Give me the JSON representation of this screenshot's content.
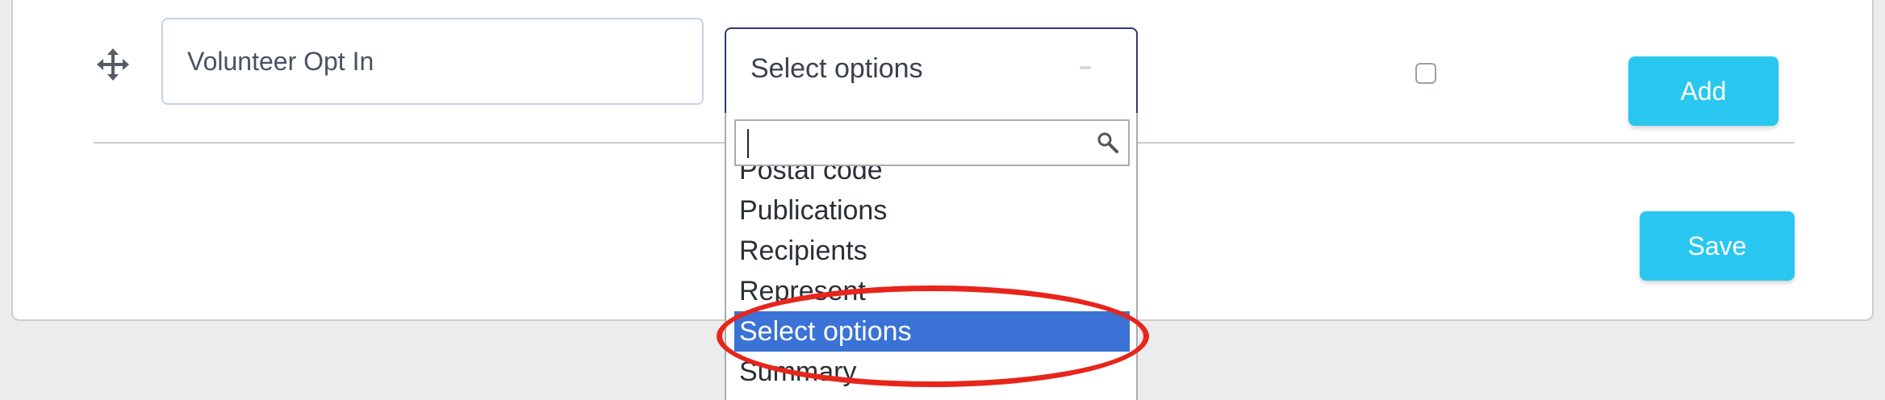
{
  "row": {
    "field_name_value": "Volunteer Opt In",
    "select_label": "Select options",
    "add_label": "Add"
  },
  "dropdown": {
    "search_value": "",
    "options": [
      "Postal code",
      "Publications",
      "Recipients",
      "Represent",
      "Select options",
      "Summary"
    ],
    "selected_option": "Select options",
    "selected_color": "#3a72d6"
  },
  "footer": {
    "save_label": "Save"
  },
  "colors": {
    "accent_button": "#29c7ef",
    "annotation_ring": "#e8251b"
  },
  "icons": {
    "drag": "move-arrows-icon",
    "search": "search-icon",
    "dropdown_arrow": "chevron-down-icon"
  }
}
